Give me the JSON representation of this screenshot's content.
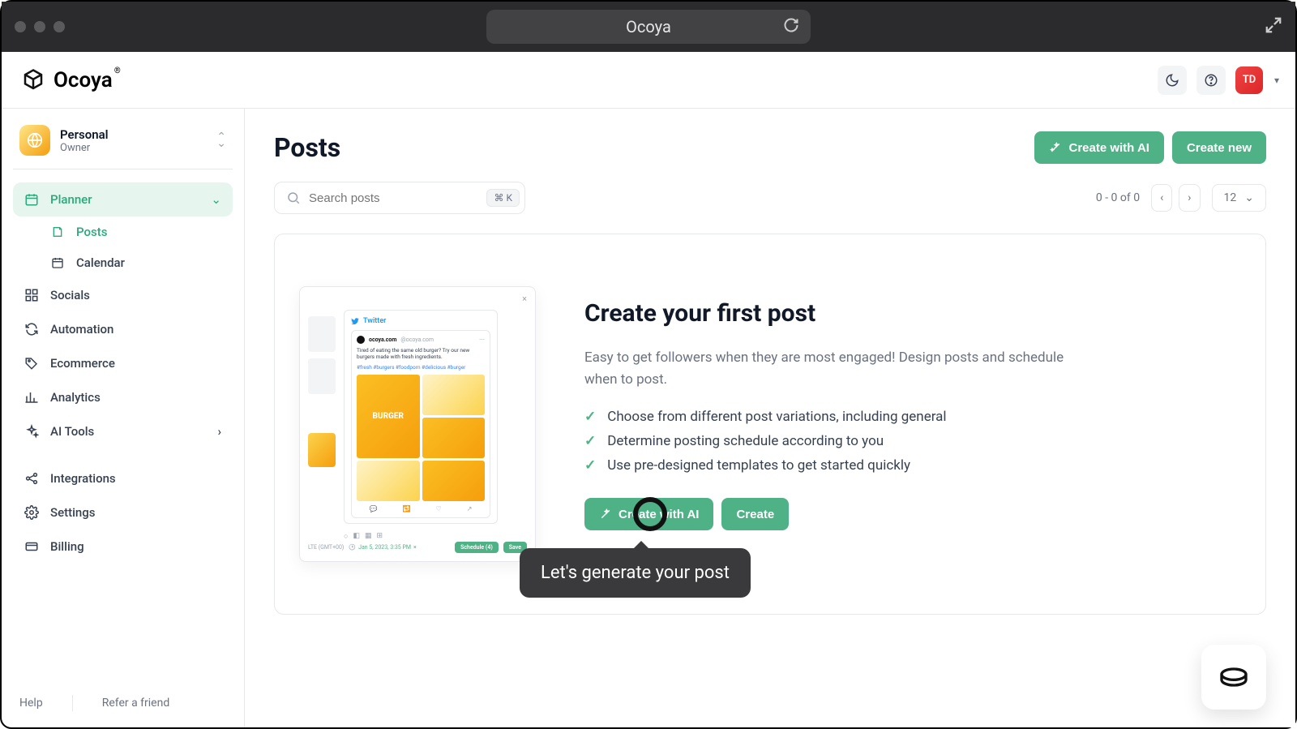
{
  "window": {
    "title": "Ocoya"
  },
  "brand": "Ocoya",
  "workspace": {
    "name": "Personal",
    "role": "Owner"
  },
  "nav": {
    "planner": "Planner",
    "posts": "Posts",
    "calendar": "Calendar",
    "socials": "Socials",
    "automation": "Automation",
    "ecommerce": "Ecommerce",
    "analytics": "Analytics",
    "aitools": "AI Tools",
    "integrations": "Integrations",
    "settings": "Settings",
    "billing": "Billing"
  },
  "footer": {
    "help": "Help",
    "refer": "Refer a friend"
  },
  "page": {
    "title": "Posts",
    "create_ai": "Create with AI",
    "create_new": "Create new",
    "search_placeholder": "Search posts",
    "search_shortcut": "⌘ K",
    "range": "0 - 0 of 0",
    "page_size": "12"
  },
  "avatar": "TD",
  "empty": {
    "title": "Create your first post",
    "desc": "Easy to get followers when they are most engaged! Design posts and schedule when to post.",
    "bullets": [
      "Choose from different post variations, including general",
      "Determine posting schedule according to you",
      "Use pre-designed templates to get started quickly"
    ],
    "btn_ai": "Create with AI",
    "btn_create": "Create",
    "tooltip": "Let's generate your post"
  },
  "mock": {
    "platform": "Twitter",
    "handle": "ocoya.com",
    "username": "@ocoya.com",
    "text": "Tired of eating the same old burger? Try our new burgers made with fresh ingredients.",
    "tags": "#fresh #burgers #foodporn #delicious #burger",
    "big_label": "BURGER",
    "timezone": "LTE (GMT+00)",
    "date": "Jan 5, 2023, 3:35 PM",
    "schedule": "Schedule (4)",
    "save": "Save"
  }
}
